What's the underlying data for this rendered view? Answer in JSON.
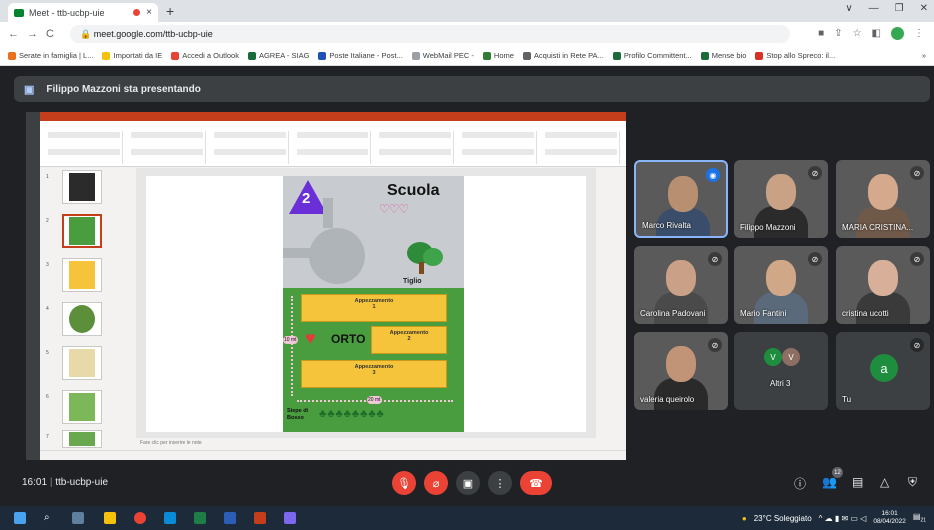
{
  "browser": {
    "tab_title": "Meet - ttb-ucbp-uie",
    "tab_close": "×",
    "new_tab": "+",
    "url": "meet.google.com/ttb-ucbp-uie",
    "nav_back": "←",
    "nav_forward": "→",
    "nav_reload": "C",
    "window_controls": [
      "∨",
      "—",
      "❐",
      "✕"
    ],
    "bookmarks": [
      {
        "label": "Serate in famiglia | L...",
        "color": "#e8711a"
      },
      {
        "label": "Importati da IE",
        "color": "#f4c20d"
      },
      {
        "label": "Accedi a Outlook",
        "color": "#e94335"
      },
      {
        "label": "AGREA - SIAG",
        "color": "#1a6b3a"
      },
      {
        "label": "Poste Italiane - Post...",
        "color": "#1f4fb5"
      },
      {
        "label": "WebMail PEC -",
        "color": "#9aa0a6"
      },
      {
        "label": "Home",
        "color": "#2e7d32"
      },
      {
        "label": "Acquisti in Rete PA...",
        "color": "#5f6368"
      },
      {
        "label": "Profilo Committent...",
        "color": "#1a6b3a"
      },
      {
        "label": "Mense bio",
        "color": "#1a6b3a"
      },
      {
        "label": "Stop allo Spreco: il...",
        "color": "#d93025"
      }
    ]
  },
  "meet": {
    "presenting_text": "Filippo Mazzoni sta presentando",
    "slide": {
      "number": "2",
      "title": "Scuola",
      "tree_label": "Tiglio",
      "plots": [
        "Appezzamento\n1",
        "Appezzamento\n2",
        "Appezzamento\n3"
      ],
      "orto_label": "ORTO",
      "dim_side": "10 mt",
      "dim_bottom": "20 mt",
      "hedge_label": "Siepe di Bosso",
      "notes_placeholder": "Fare clic per inserire le note"
    },
    "participants": [
      {
        "name": "Marco Rivalta",
        "active": true,
        "skin": "#b98f72",
        "shirt": "#3a4d6a"
      },
      {
        "name": "Filippo Mazzoni",
        "active": false,
        "skin": "#c9a184",
        "shirt": "#2b2b2b"
      },
      {
        "name": "MARIA CRISTINA...",
        "active": false,
        "skin": "#d4a98c",
        "shirt": "#6f5a4a"
      },
      {
        "name": "Carolina Padovani",
        "active": false,
        "skin": "#caa086",
        "shirt": "#4a4a4a"
      },
      {
        "name": "Mario Fantini",
        "active": false,
        "skin": "#d0a887",
        "shirt": "#5a6a7a"
      },
      {
        "name": "cristina ucotti",
        "active": false,
        "skin": "#d8b09a",
        "shirt": "#3a3a3a"
      },
      {
        "name": "valeria queirolo",
        "active": false,
        "skin": "#c19478",
        "shirt": "#2a2a2a"
      }
    ],
    "others": {
      "label": "Altri 3",
      "initials": [
        "V",
        "V"
      ]
    },
    "self": {
      "label": "Tu",
      "initial": "a"
    },
    "meeting_time": "16:01",
    "meeting_code": "ttb-ucbp-uie",
    "participant_count": "12"
  },
  "taskbar": {
    "weather": "23°C Soleggiato",
    "time": "16:01",
    "date": "08/04/2022",
    "notification_count": "21"
  },
  "colors": {
    "meet_bg": "#202124",
    "end_call": "#ea4335",
    "ppt_accent": "#c43e1c"
  }
}
